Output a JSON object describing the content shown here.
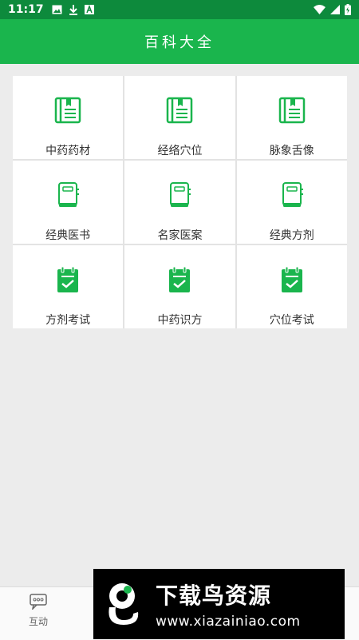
{
  "status_bar": {
    "time": "11:17",
    "left_icons": [
      "image-icon",
      "download-icon",
      "a-icon"
    ],
    "right_icons": [
      "wifi-icon",
      "signal-icon",
      "battery-icon"
    ]
  },
  "app_bar": {
    "title": "百科大全"
  },
  "grid": {
    "items": [
      {
        "label": "中药药材",
        "icon": "book-open-icon"
      },
      {
        "label": "经络穴位",
        "icon": "book-open-icon"
      },
      {
        "label": "脉象舌像",
        "icon": "book-open-icon"
      },
      {
        "label": "经典医书",
        "icon": "book-closed-icon"
      },
      {
        "label": "名家医案",
        "icon": "book-closed-icon"
      },
      {
        "label": "经典方剂",
        "icon": "book-closed-icon"
      },
      {
        "label": "方剂考试",
        "icon": "clipboard-check-icon"
      },
      {
        "label": "中药识方",
        "icon": "clipboard-check-icon"
      },
      {
        "label": "穴位考试",
        "icon": "clipboard-check-icon"
      }
    ]
  },
  "bottom_nav": {
    "items": [
      {
        "label": "互动",
        "icon": "chat-bubble-icon"
      }
    ]
  },
  "watermark": {
    "title": "下载鸟资源",
    "url": "www.xiazainiao.com"
  },
  "colors": {
    "status_bar": "#0d8a3c",
    "accent": "#1ab54d",
    "background": "#ececec"
  }
}
